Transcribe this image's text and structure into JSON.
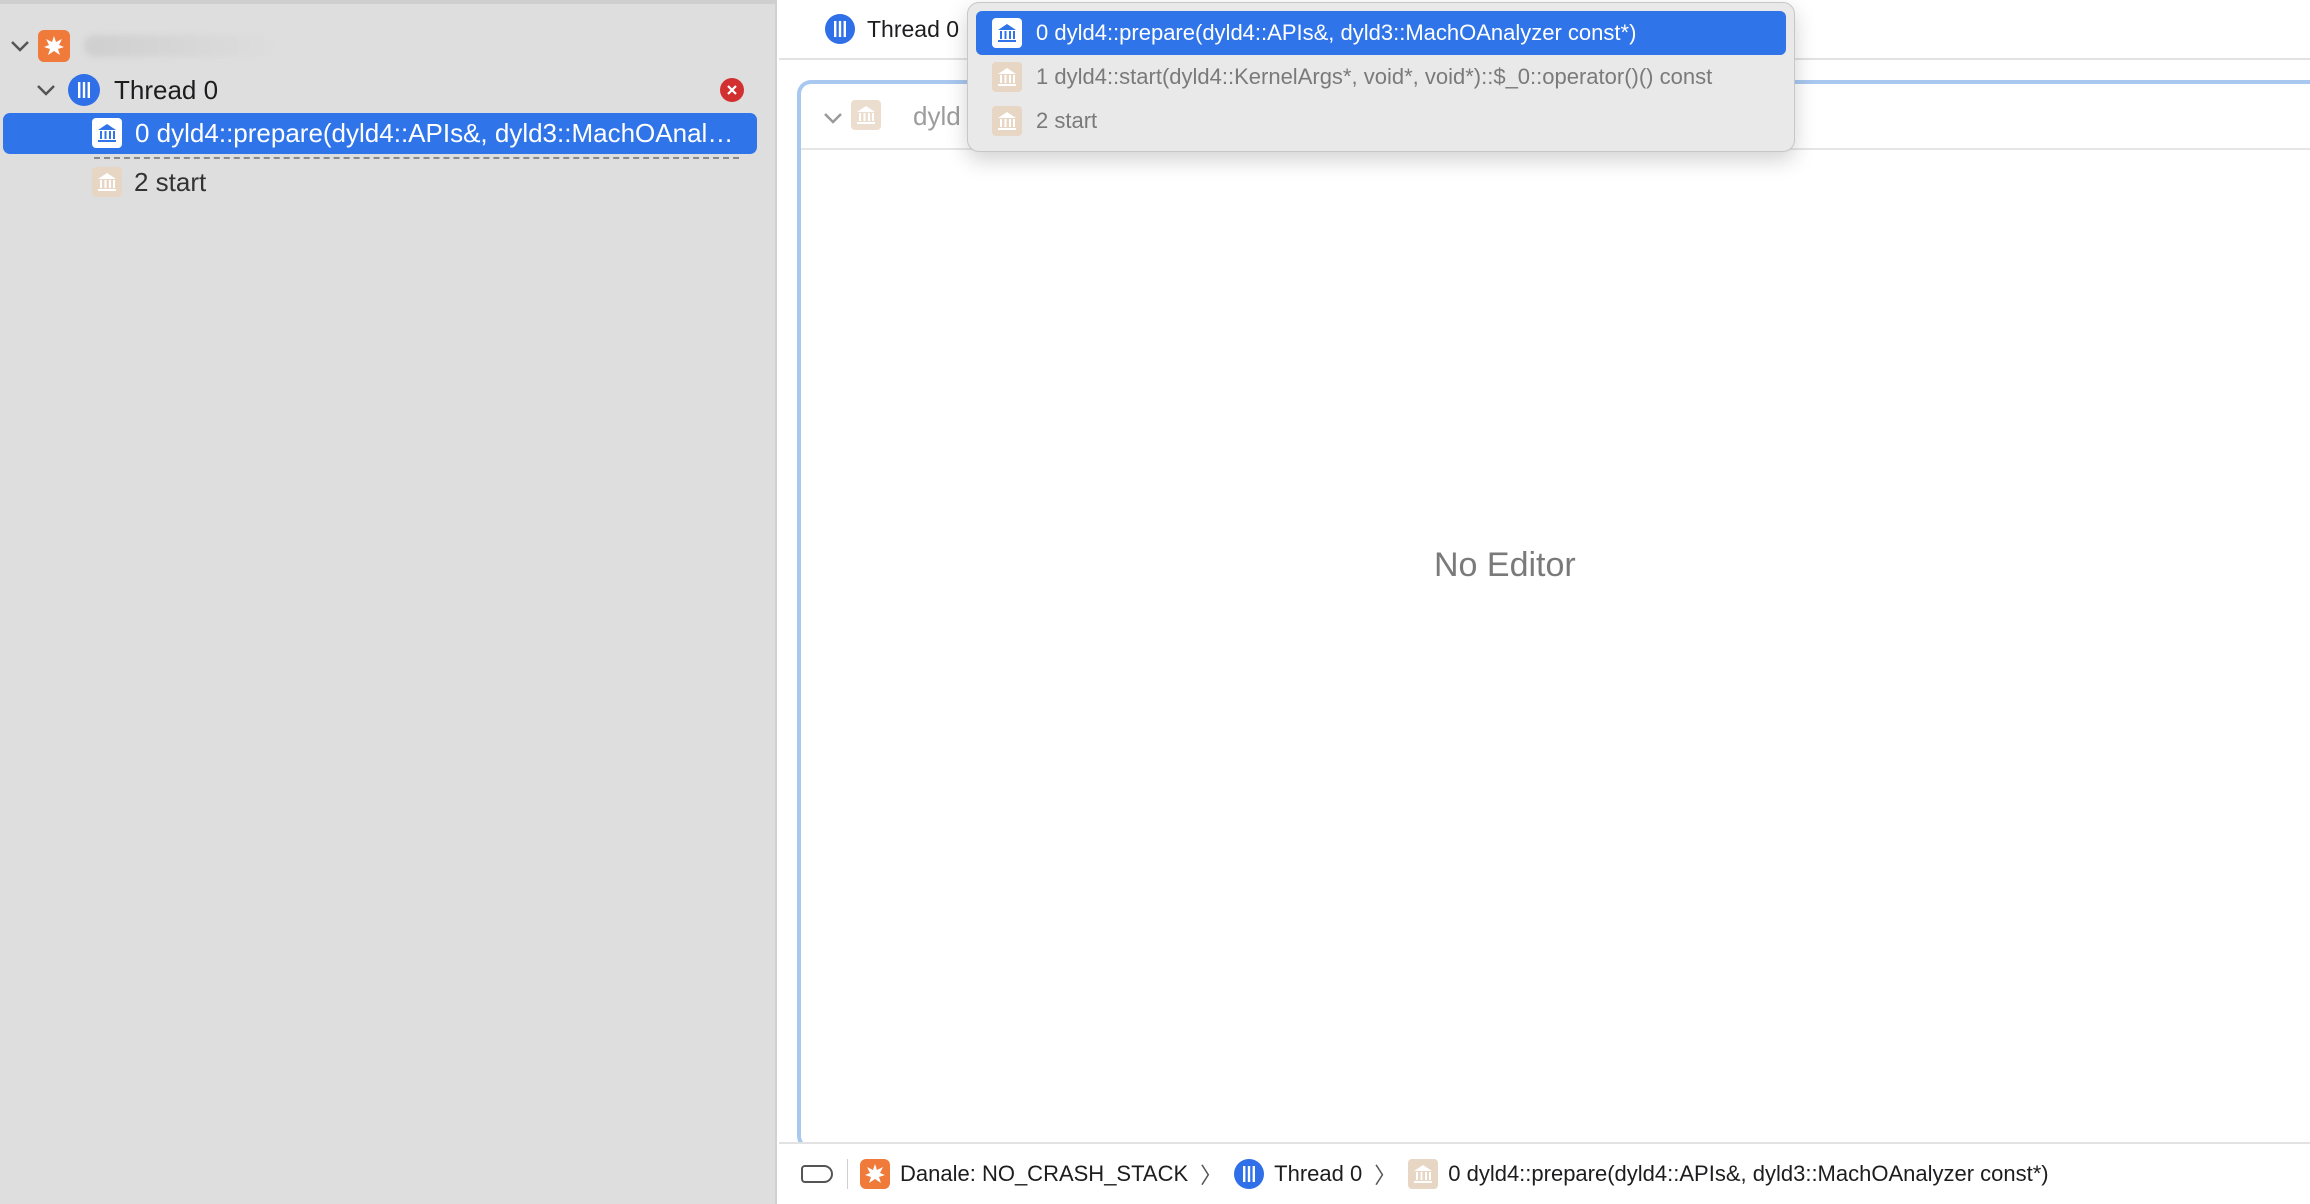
{
  "sidebar": {
    "thread_label": "Thread 0",
    "frames": [
      {
        "label": "0 dyld4::prepare(dyld4::APIs&, dyld3::MachOAnalyzer const*)"
      },
      {
        "label": "2 start"
      }
    ]
  },
  "topbar": {
    "thread_label": "Thread 0"
  },
  "editor": {
    "header_label": "dyld",
    "placeholder": "No Editor"
  },
  "popup": {
    "items": [
      {
        "label": "0 dyld4::prepare(dyld4::APIs&, dyld3::MachOAnalyzer const*)"
      },
      {
        "label": "1 dyld4::start(dyld4::KernelArgs*, void*, void*)::$_0::operator()() const"
      },
      {
        "label": "2 start"
      }
    ]
  },
  "breadcrumb": {
    "app": "Danale: NO_CRASH_STACK",
    "thread": "Thread 0",
    "frame": "0 dyld4::prepare(dyld4::APIs&, dyld3::MachOAnalyzer const*)"
  },
  "colors": {
    "accent": "#2f74e8",
    "app_icon": "#f07a3a",
    "library_icon": "#e8d6c4",
    "error": "#d23030"
  }
}
